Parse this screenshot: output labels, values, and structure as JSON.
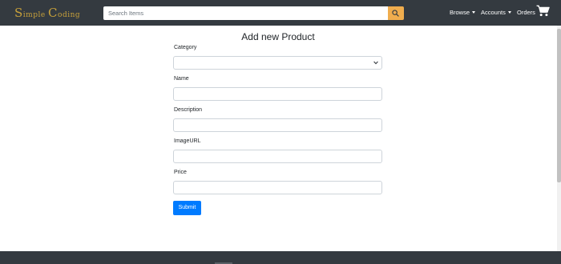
{
  "navbar": {
    "brand": {
      "s": "S",
      "imple": "imple",
      "c": "C",
      "oding": "oding"
    },
    "search": {
      "placeholder": "Search Items"
    },
    "menu": {
      "browse": "Browse",
      "accounts": "Accounts",
      "orders": "Orders"
    }
  },
  "page": {
    "title": "Add new Product"
  },
  "form": {
    "category": {
      "label": "Category",
      "value": ""
    },
    "name": {
      "label": "Name",
      "value": ""
    },
    "description": {
      "label": "Description",
      "value": ""
    },
    "image_url": {
      "label": "ImageURL",
      "value": ""
    },
    "price": {
      "label": "Price",
      "value": ""
    },
    "submit_label": "Submit"
  },
  "colors": {
    "navbar_bg": "#343a40",
    "brand_gold": "#c8a13a",
    "search_button": "#f0ad4e",
    "primary": "#007bff"
  },
  "icons": {
    "search": "search-icon",
    "cart": "cart-icon",
    "dropdown": "caret-down-icon",
    "select": "chevron-down-icon"
  }
}
